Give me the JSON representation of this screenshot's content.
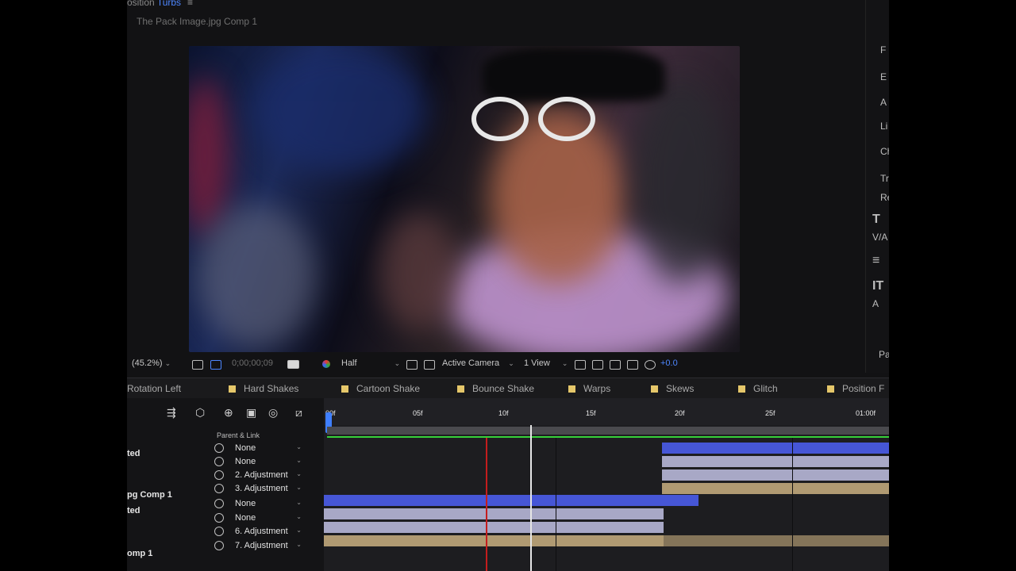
{
  "panel": {
    "title_prefix": "osition ",
    "title_hl": "Turbs",
    "menu": "≡"
  },
  "comp_tab": "The Pack Image.jpg Comp 1",
  "viewer_toolbar": {
    "zoom": "(45.2%)",
    "timecode": "0;00;00;09",
    "resolution": "Half",
    "camera": "Active Camera",
    "views": "1 View",
    "exposure": "+0.0"
  },
  "tabs": [
    {
      "label": "Rotation Left"
    },
    {
      "label": "Hard Shakes"
    },
    {
      "label": "Cartoon Shake"
    },
    {
      "label": "Bounce Shake"
    },
    {
      "label": "Warps"
    },
    {
      "label": "Skews"
    },
    {
      "label": "Glitch"
    },
    {
      "label": "Position F"
    }
  ],
  "timeline": {
    "parent_header": "Parent & Link",
    "layer_names": [
      "ted",
      "pg Comp 1",
      "ted",
      "omp 1"
    ],
    "parents": [
      {
        "value": "None"
      },
      {
        "value": "None"
      },
      {
        "value": "2. Adjustment"
      },
      {
        "value": "3. Adjustment"
      },
      {
        "value": "None"
      },
      {
        "value": "None"
      },
      {
        "value": "6. Adjustment"
      },
      {
        "value": "7. Adjustment"
      }
    ],
    "ticks": [
      "00f",
      "05f",
      "10f",
      "15f",
      "20f",
      "25f",
      "01:00f"
    ]
  },
  "side_panel": [
    "F",
    "E",
    "A",
    "Li",
    "Ch",
    "Tr",
    "Re",
    "T",
    "V/A",
    "≡",
    "IT",
    "A",
    "Pa"
  ],
  "colors": {
    "accent": "#4d86ff",
    "label_yellow": "#e5c76a",
    "layer_blue": "#4656d6",
    "layer_lavender": "#a8a8c6",
    "layer_tan": "#b09a72",
    "green": "#37d13a"
  }
}
